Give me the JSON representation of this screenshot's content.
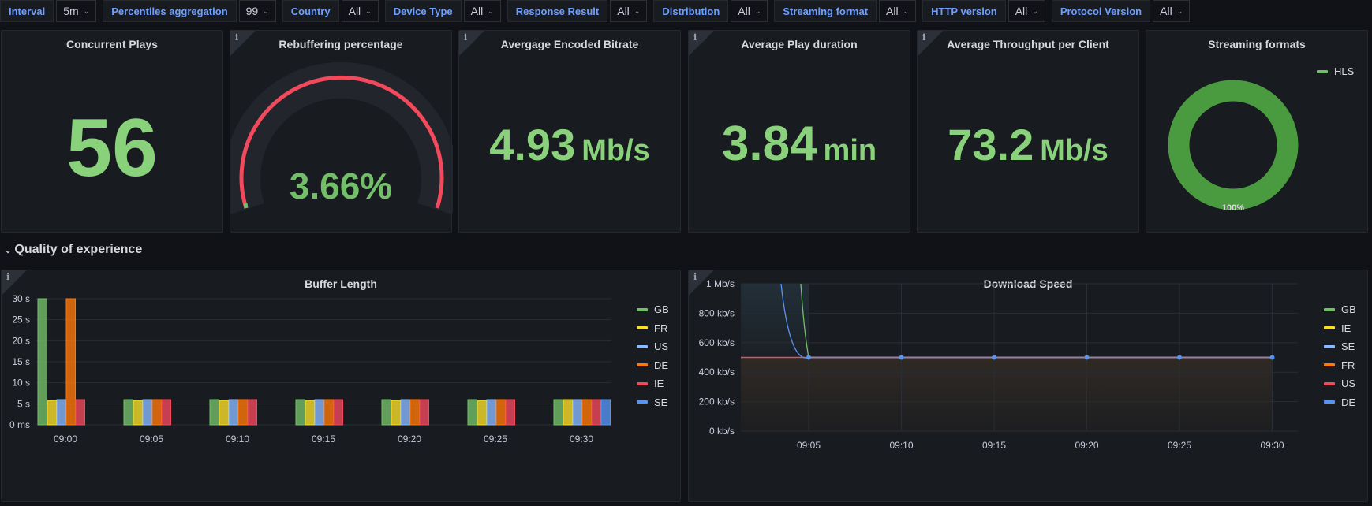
{
  "variables": [
    {
      "label": "Interval",
      "value": "5m"
    },
    {
      "label": "Percentiles aggregation",
      "value": "99"
    },
    {
      "label": "Country",
      "value": "All"
    },
    {
      "label": "Device Type",
      "value": "All"
    },
    {
      "label": "Response Result",
      "value": "All"
    },
    {
      "label": "Distribution",
      "value": "All"
    },
    {
      "label": "Streaming format",
      "value": "All"
    },
    {
      "label": "HTTP version",
      "value": "All"
    },
    {
      "label": "Protocol Version",
      "value": "All"
    }
  ],
  "stats": {
    "concurrent_plays": {
      "title": "Concurrent Plays",
      "value": "56"
    },
    "rebuffering": {
      "title": "Rebuffering percentage",
      "value": "3.66%",
      "fraction": 0.0366
    },
    "encoded_bitrate": {
      "title": "Avergage Encoded Bitrate",
      "value": "4.93",
      "unit": "Mb/s"
    },
    "play_duration": {
      "title": "Average Play duration",
      "value": "3.84",
      "unit": "min"
    },
    "throughput": {
      "title": "Average Throughput per Client",
      "value": "73.2",
      "unit": "Mb/s"
    },
    "streaming_formats": {
      "title": "Streaming formats",
      "legend": "HLS",
      "slice_label": "100%"
    }
  },
  "row": {
    "title": "Quality of experience"
  },
  "colors": {
    "green": "#73bf69",
    "yellow": "#fade2a",
    "lightblue": "#8ab8ff",
    "orange": "#ff780a",
    "red": "#f2495c",
    "blue": "#5794f2"
  },
  "chart_data": [
    {
      "type": "pie",
      "title": "Streaming formats",
      "labels": [
        "HLS"
      ],
      "values": [
        100
      ],
      "legend": "top-right"
    },
    {
      "type": "bar",
      "title": "Buffer Length",
      "categories": [
        "09:00",
        "09:05",
        "09:10",
        "09:15",
        "09:20",
        "09:25",
        "09:30"
      ],
      "yticks": [
        "0 ms",
        "5 s",
        "10 s",
        "15 s",
        "20 s",
        "25 s",
        "30 s"
      ],
      "ylim": [
        0,
        30
      ],
      "legend": "right",
      "series": [
        {
          "name": "GB",
          "color": "#73bf69",
          "values": [
            30,
            6,
            6,
            6,
            6,
            6,
            6
          ]
        },
        {
          "name": "FR",
          "color": "#fade2a",
          "values": [
            5.8,
            5.8,
            5.8,
            5.8,
            5.8,
            5.8,
            6
          ]
        },
        {
          "name": "US",
          "color": "#8ab8ff",
          "values": [
            6,
            6,
            6,
            6,
            6,
            6,
            6
          ]
        },
        {
          "name": "DE",
          "color": "#ff780a",
          "values": [
            30,
            6,
            6,
            6,
            6,
            6,
            6
          ]
        },
        {
          "name": "IE",
          "color": "#f2495c",
          "values": [
            6,
            6,
            6,
            6,
            6,
            6,
            6
          ]
        },
        {
          "name": "SE",
          "color": "#5794f2",
          "values": [
            null,
            null,
            null,
            null,
            null,
            null,
            6
          ]
        }
      ]
    },
    {
      "type": "line",
      "title": "Download Speed",
      "x": [
        "09:05",
        "09:10",
        "09:15",
        "09:20",
        "09:25",
        "09:30"
      ],
      "yticks": [
        "0 kb/s",
        "200 kb/s",
        "400 kb/s",
        "600 kb/s",
        "800 kb/s",
        "1 Mb/s"
      ],
      "ylim": [
        0,
        1000
      ],
      "legend": "right",
      "series": [
        {
          "name": "GB",
          "color": "#73bf69",
          "values": [
            500,
            500,
            500,
            500,
            500,
            500
          ]
        },
        {
          "name": "IE",
          "color": "#fade2a",
          "values": [
            500,
            500,
            500,
            500,
            500,
            500
          ]
        },
        {
          "name": "SE",
          "color": "#8ab8ff",
          "values": [
            500,
            500,
            500,
            500,
            500,
            500
          ]
        },
        {
          "name": "FR",
          "color": "#ff780a",
          "values": [
            500,
            500,
            500,
            500,
            500,
            500
          ]
        },
        {
          "name": "US",
          "color": "#f2495c",
          "values": [
            500,
            500,
            500,
            500,
            500,
            500
          ]
        },
        {
          "name": "DE",
          "color": "#5794f2",
          "values": [
            500,
            500,
            500,
            500,
            500,
            500
          ]
        }
      ]
    }
  ]
}
